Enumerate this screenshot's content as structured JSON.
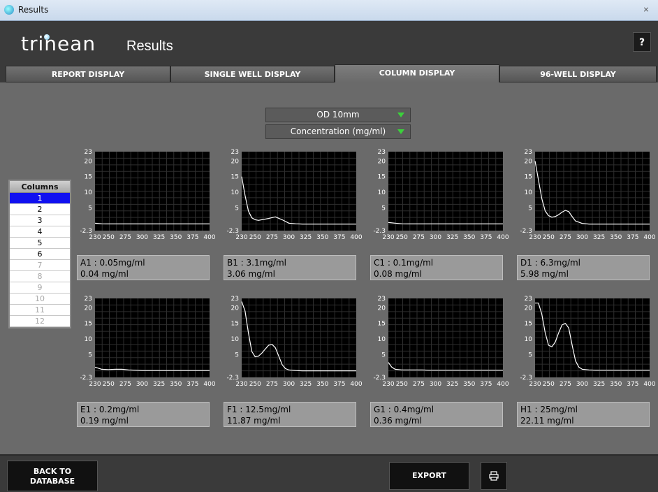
{
  "window": {
    "title": "Results",
    "close_label": "⨯"
  },
  "header": {
    "logo_text": "trinean",
    "title": "Results",
    "help_label": "?"
  },
  "tabs": [
    {
      "label": "REPORT DISPLAY",
      "active": false
    },
    {
      "label": "SINGLE WELL DISPLAY",
      "active": false
    },
    {
      "label": "COLUMN DISPLAY",
      "active": true
    },
    {
      "label": "96-WELL DISPLAY",
      "active": false
    }
  ],
  "dropdowns": {
    "path": {
      "value": "OD 10mm"
    },
    "unit": {
      "value": "Concentration (mg/ml)"
    }
  },
  "columns": {
    "header": "Columns",
    "items": [
      "1",
      "2",
      "3",
      "4",
      "5",
      "6",
      "7",
      "8",
      "9",
      "10",
      "11",
      "12"
    ],
    "selected": "1",
    "enabled_count": 6
  },
  "chart_data": [
    {
      "type": "line",
      "well": "A1",
      "line1": "A1 : 0.05mg/ml",
      "line2": "0.04 mg/ml",
      "x": [
        230,
        240,
        250,
        260,
        270,
        280,
        290,
        300,
        310,
        320,
        330,
        340,
        350,
        360,
        370,
        380,
        390,
        400
      ],
      "y": [
        0.1,
        -0.1,
        -0.15,
        -0.15,
        -0.15,
        -0.15,
        -0.15,
        -0.15,
        -0.15,
        -0.15,
        -0.15,
        -0.15,
        -0.15,
        -0.15,
        -0.15,
        -0.15,
        -0.15,
        -0.15
      ],
      "xticks": [
        "230",
        "250",
        "275",
        "300",
        "325",
        "350",
        "375",
        "400"
      ],
      "yticks": [
        "23",
        "20",
        "15",
        "10",
        "5",
        "-2.3"
      ],
      "ylim": [
        -2.3,
        23
      ]
    },
    {
      "type": "line",
      "well": "B1",
      "line1": "B1 : 3.1mg/ml",
      "line2": "3.06 mg/ml",
      "x": [
        230,
        235,
        240,
        245,
        250,
        255,
        260,
        270,
        280,
        290,
        300,
        310,
        320,
        330,
        340,
        350,
        360,
        370,
        380,
        390,
        400
      ],
      "y": [
        15,
        9,
        4,
        1.8,
        1.2,
        1.0,
        1.2,
        1.6,
        2.1,
        1.2,
        0.1,
        -0.1,
        -0.2,
        -0.2,
        -0.2,
        -0.2,
        -0.2,
        -0.2,
        -0.2,
        -0.2,
        -0.2
      ],
      "xticks": [
        "230",
        "250",
        "275",
        "300",
        "325",
        "350",
        "375",
        "400"
      ],
      "yticks": [
        "23",
        "20",
        "15",
        "10",
        "5",
        "-2.3"
      ],
      "ylim": [
        -2.3,
        23
      ]
    },
    {
      "type": "line",
      "well": "C1",
      "line1": "C1 : 0.1mg/ml",
      "line2": "0.08 mg/ml",
      "x": [
        230,
        240,
        250,
        260,
        270,
        280,
        290,
        300,
        310,
        320,
        330,
        340,
        350,
        360,
        370,
        380,
        390,
        400
      ],
      "y": [
        0.3,
        0.1,
        -0.1,
        -0.15,
        -0.15,
        -0.15,
        -0.15,
        -0.15,
        -0.15,
        -0.15,
        -0.15,
        -0.15,
        -0.15,
        -0.15,
        -0.15,
        -0.15,
        -0.15,
        -0.15
      ],
      "xticks": [
        "230",
        "250",
        "275",
        "300",
        "325",
        "350",
        "375",
        "400"
      ],
      "yticks": [
        "23",
        "20",
        "15",
        "10",
        "5",
        "-2.3"
      ],
      "ylim": [
        -2.3,
        23
      ]
    },
    {
      "type": "line",
      "well": "D1",
      "line1": "D1 : 6.3mg/ml",
      "line2": "5.98 mg/ml",
      "x": [
        230,
        235,
        240,
        245,
        250,
        255,
        260,
        265,
        270,
        275,
        280,
        285,
        290,
        300,
        310,
        320,
        330,
        340,
        350,
        360,
        370,
        380,
        390,
        400
      ],
      "y": [
        20,
        14,
        8,
        4,
        2.5,
        2.0,
        2.2,
        2.8,
        3.6,
        4.2,
        3.8,
        2.2,
        0.8,
        0,
        -0.2,
        -0.2,
        -0.2,
        -0.2,
        -0.2,
        -0.2,
        -0.2,
        -0.2,
        -0.2,
        -0.2
      ],
      "xticks": [
        "230",
        "250",
        "275",
        "300",
        "325",
        "350",
        "375",
        "400"
      ],
      "yticks": [
        "23",
        "20",
        "15",
        "10",
        "5",
        "-2.3"
      ],
      "ylim": [
        -2.3,
        23
      ]
    },
    {
      "type": "line",
      "well": "E1",
      "line1": "E1 : 0.2mg/ml",
      "line2": "0.19 mg/ml",
      "x": [
        230,
        240,
        250,
        260,
        270,
        280,
        290,
        300,
        310,
        320,
        330,
        340,
        350,
        360,
        370,
        380,
        390,
        400
      ],
      "y": [
        1.0,
        0.3,
        0.2,
        0.3,
        0.3,
        0.1,
        0.0,
        -0.1,
        -0.1,
        -0.1,
        -0.1,
        -0.1,
        -0.1,
        -0.1,
        -0.1,
        -0.1,
        -0.1,
        -0.1
      ],
      "xticks": [
        "230",
        "250",
        "275",
        "300",
        "325",
        "350",
        "375",
        "400"
      ],
      "yticks": [
        "23",
        "20",
        "15",
        "10",
        "5",
        "-2.3"
      ],
      "ylim": [
        -2.3,
        23
      ]
    },
    {
      "type": "line",
      "well": "F1",
      "line1": "F1 : 12.5mg/ml",
      "line2": "11.87 mg/ml",
      "x": [
        230,
        235,
        240,
        245,
        250,
        255,
        260,
        265,
        270,
        275,
        280,
        285,
        290,
        295,
        300,
        310,
        320,
        330,
        340,
        350,
        360,
        370,
        380,
        390,
        400
      ],
      "y": [
        22,
        19,
        12,
        6,
        4.3,
        4.5,
        5.5,
        6.8,
        8.0,
        8.3,
        7.2,
        4.5,
        1.8,
        0.5,
        0.1,
        -0.1,
        -0.2,
        -0.2,
        -0.2,
        -0.2,
        -0.2,
        -0.2,
        -0.2,
        -0.2,
        -0.2
      ],
      "xticks": [
        "230",
        "250",
        "275",
        "300",
        "325",
        "350",
        "375",
        "400"
      ],
      "yticks": [
        "23",
        "20",
        "15",
        "10",
        "5",
        "-2.3"
      ],
      "ylim": [
        -2.3,
        23
      ]
    },
    {
      "type": "line",
      "well": "G1",
      "line1": "G1 : 0.4mg/ml",
      "line2": "0.36 mg/ml",
      "x": [
        230,
        235,
        240,
        250,
        260,
        270,
        280,
        290,
        300,
        310,
        320,
        330,
        340,
        350,
        360,
        370,
        380,
        390,
        400
      ],
      "y": [
        2.5,
        1.0,
        0.3,
        0.1,
        0.1,
        0.1,
        0.1,
        0,
        0,
        0,
        0,
        0,
        0,
        0,
        0,
        0,
        0,
        0,
        0
      ],
      "xticks": [
        "230",
        "250",
        "275",
        "300",
        "325",
        "350",
        "375",
        "400"
      ],
      "yticks": [
        "23",
        "20",
        "15",
        "10",
        "5",
        "-2.3"
      ],
      "ylim": [
        -2.3,
        23
      ]
    },
    {
      "type": "line",
      "well": "H1",
      "line1": "H1 : 25mg/ml",
      "line2": "22.11 mg/ml",
      "x": [
        230,
        235,
        240,
        245,
        250,
        255,
        260,
        265,
        270,
        275,
        280,
        285,
        290,
        295,
        300,
        310,
        320,
        330,
        340,
        350,
        360,
        370,
        380,
        390,
        400
      ],
      "y": [
        21.5,
        21.5,
        18,
        12,
        8,
        7.5,
        9,
        12,
        14.5,
        15,
        13.5,
        8,
        3,
        1,
        0.3,
        0.1,
        0,
        0,
        0,
        0,
        0,
        0,
        0,
        0,
        0
      ],
      "xticks": [
        "230",
        "250",
        "275",
        "300",
        "325",
        "350",
        "375",
        "400"
      ],
      "yticks": [
        "23",
        "20",
        "15",
        "10",
        "5",
        "-2.3"
      ],
      "ylim": [
        -2.3,
        23
      ]
    }
  ],
  "footer": {
    "back_label_1": "BACK TO",
    "back_label_2": "DATABASE",
    "export_label": "EXPORT",
    "print_icon": "printer-icon"
  },
  "colors": {
    "selected_column": "#1010f0",
    "dropdown_arrow": "#3bd23b",
    "plot_bg": "#000000",
    "plot_line": "#ffffff"
  }
}
